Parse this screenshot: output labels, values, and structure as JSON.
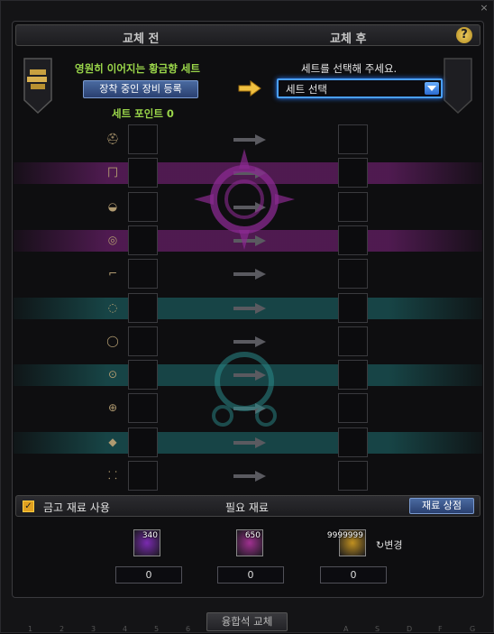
{
  "header": {
    "before_label": "교체 전",
    "after_label": "교체 후",
    "help_label": "?"
  },
  "left": {
    "set_name": "영원히 이어지는 황금향 세트",
    "register_button": "장착 중인 장비 등록",
    "set_points": "세트 포인트 0"
  },
  "right": {
    "select_prompt": "세트를 선택해 주세요.",
    "select_value": "세트 선택"
  },
  "slots": [
    {
      "icon": "helmet-icon",
      "glyph": "⛑",
      "band": "none"
    },
    {
      "icon": "pants-icon",
      "glyph": "⼌",
      "band": "pink"
    },
    {
      "icon": "shoulder-icon",
      "glyph": "◒",
      "band": "none"
    },
    {
      "icon": "belt-icon",
      "glyph": "◎",
      "band": "pink"
    },
    {
      "icon": "boots-icon",
      "glyph": "⌐",
      "band": "none"
    },
    {
      "icon": "necklace-icon",
      "glyph": "◌",
      "band": "teal"
    },
    {
      "icon": "bracelet-icon",
      "glyph": "◯",
      "band": "none"
    },
    {
      "icon": "ring-icon",
      "glyph": "⊙",
      "band": "teal"
    },
    {
      "icon": "support-icon",
      "glyph": "⊕",
      "band": "none"
    },
    {
      "icon": "magic-stone-icon",
      "glyph": "◆",
      "band": "teal"
    },
    {
      "icon": "earring-icon",
      "glyph": "⸬",
      "band": "none"
    }
  ],
  "bottom": {
    "checkbox_label": "금고 재료 사용",
    "need_label": "필요 재료",
    "shop_button": "재료 상점",
    "checked": true
  },
  "materials": [
    {
      "name": "purple-material-icon",
      "count": "340",
      "qty": "0",
      "color": "#7a2ab0"
    },
    {
      "name": "magenta-material-icon",
      "count": "650",
      "qty": "0",
      "color": "#a03090"
    },
    {
      "name": "gold-coin-icon",
      "count": "9999999",
      "qty": "0",
      "color": "#c09020"
    }
  ],
  "change_label": "↻변경",
  "fuse_button": "융합석 교체",
  "hotkeys": [
    "1",
    "2",
    "3",
    "4",
    "5",
    "6",
    "",
    "",
    "",
    "",
    "A",
    "S",
    "D",
    "F",
    "G"
  ],
  "colors": {
    "accent_blue": "#4aa0ff",
    "set_green": "#9ad64a",
    "pink_band": "#c832c8",
    "teal_band": "#28aaaa"
  }
}
